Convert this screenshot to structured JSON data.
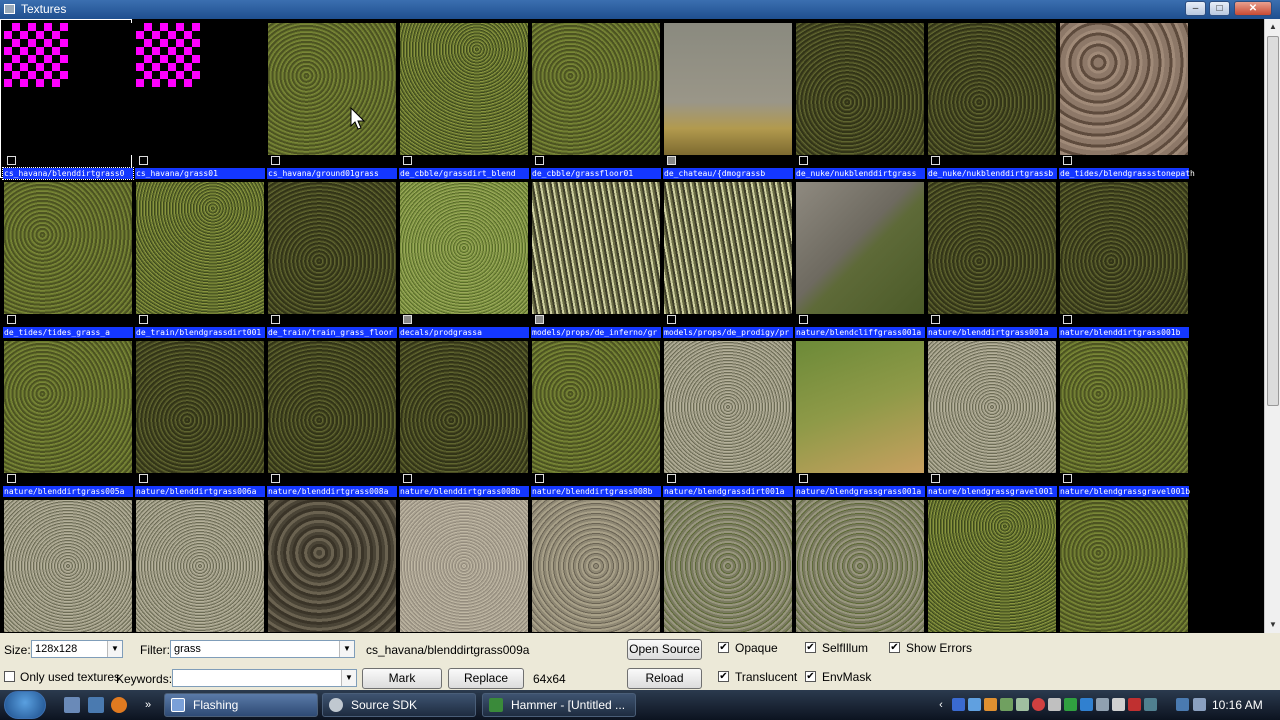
{
  "window": {
    "title": "Textures"
  },
  "textures": [
    {
      "name": "cs_havana/blenddirtgrass0",
      "look": "missing",
      "selected": true
    },
    {
      "name": "cs_havana/grass01",
      "look": "missing"
    },
    {
      "name": "cs_havana/ground01grass",
      "look": "grass"
    },
    {
      "name": "de_cbble/grassdirt_blend",
      "look": "grass2"
    },
    {
      "name": "de_cbble/grassfloor01",
      "look": "grass"
    },
    {
      "name": "de_chateau/{dmograssb",
      "look": "plant",
      "grey": true
    },
    {
      "name": "de_nuke/nukblenddirtgrass",
      "look": "darkgrass"
    },
    {
      "name": "de_nuke/nukblenddirtgrassb",
      "look": "darkgrass"
    },
    {
      "name": "de_tides/blendgrassstonepath",
      "look": "dirtstones"
    },
    {
      "name": "de_tides/tides_grass_a",
      "look": "grass"
    },
    {
      "name": "de_train/blendgrassdirt001",
      "look": "grass2"
    },
    {
      "name": "de_train/train_grass_floor",
      "look": "darkgrass"
    },
    {
      "name": "decals/prodgrassa",
      "look": "brightgrass",
      "grey": true
    },
    {
      "name": "models/props/de_inferno/gr",
      "look": "tallgrass",
      "grey": true
    },
    {
      "name": "models/props/de_prodigy/pr",
      "look": "tallgrass"
    },
    {
      "name": "nature/blendcliffgrass001a",
      "look": "rockdirt"
    },
    {
      "name": "nature/blenddirtgrass001a",
      "look": "darkgrass"
    },
    {
      "name": "nature/blenddirtgrass001b",
      "look": "darkgrass"
    },
    {
      "name": "nature/blenddirtgrass005a",
      "look": "grass"
    },
    {
      "name": "nature/blenddirtgrass006a",
      "look": "darkgrass"
    },
    {
      "name": "nature/blenddirtgrass008a",
      "look": "darkgrass"
    },
    {
      "name": "nature/blenddirtgrass008b",
      "look": "darkgrass"
    },
    {
      "name": "nature/blenddirtgrass008b",
      "look": "grass"
    },
    {
      "name": "nature/blendgrassdirt001a",
      "look": "gravelgrass"
    },
    {
      "name": "nature/blendgrassgrass001a",
      "look": "sandygrass"
    },
    {
      "name": "nature/blendgrassgravel001",
      "look": "gravelgrass"
    },
    {
      "name": "nature/blendgrassgravel001b",
      "look": "grass"
    },
    {
      "name": "",
      "look": "gravelgrass"
    },
    {
      "name": "",
      "look": "gravelgrass"
    },
    {
      "name": "",
      "look": "mud"
    },
    {
      "name": "",
      "look": "sand"
    },
    {
      "name": "",
      "look": "drydirt"
    },
    {
      "name": "",
      "look": "mossdirt"
    },
    {
      "name": "",
      "look": "mossdirt"
    },
    {
      "name": "",
      "look": "grass2"
    },
    {
      "name": "",
      "look": "grass"
    }
  ],
  "controls": {
    "size_label": "Size:",
    "size_value": "128x128",
    "filter_label": "Filter:",
    "filter_value": "grass",
    "current_texture": "cs_havana/blenddirtgrass009a",
    "current_size": "64x64",
    "only_used_label": "Only used textures",
    "keywords_label": "Keywords:",
    "keywords_value": "",
    "mark_label": "Mark",
    "replace_label": "Replace",
    "open_source_label": "Open Source",
    "reload_label": "Reload",
    "opaque_label": "Opaque",
    "translucent_label": "Translucent",
    "selfillum_label": "SelfIllum",
    "envmask_label": "EnvMask",
    "show_errors_label": "Show Errors",
    "checkmark": "✔"
  },
  "taskbar": {
    "tasks": [
      {
        "label": "Flashing",
        "active": true
      },
      {
        "label": "Source SDK"
      },
      {
        "label": "Hammer - [Untitled ..."
      }
    ],
    "clock": "10:16 AM"
  }
}
